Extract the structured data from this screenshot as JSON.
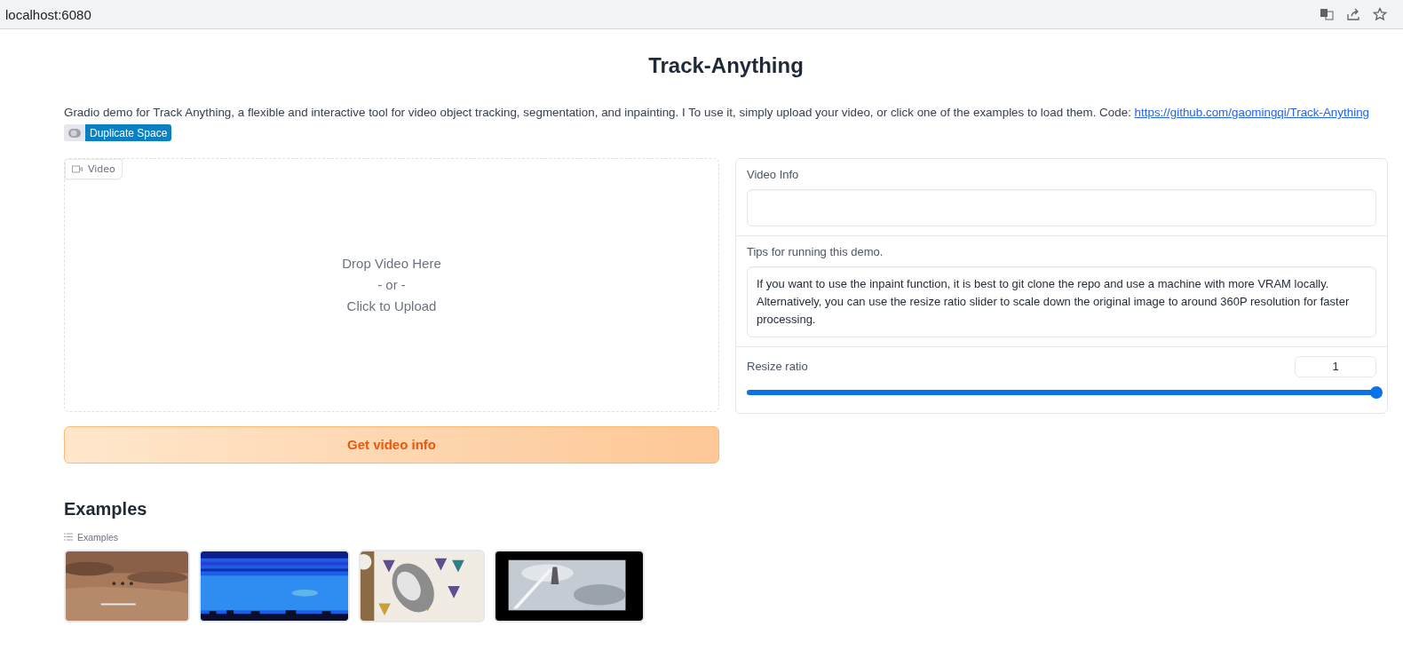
{
  "browser": {
    "address": "localhost:6080"
  },
  "title": "Track-Anything",
  "description": {
    "text": "Gradio demo for Track Anything, a flexible and interactive tool for video object tracking, segmentation, and inpainting. I To use it, simply upload your video, or click one of the examples to load them. Code: ",
    "link": "https://github.com/gaomingqi/Track-Anything"
  },
  "badge": {
    "label": "Duplicate Space"
  },
  "video": {
    "label": "Video",
    "drop_lines": [
      "Drop Video Here",
      "- or -",
      "Click to Upload"
    ]
  },
  "button": {
    "label": "Get video info"
  },
  "video_info": {
    "label": "Video Info"
  },
  "tips": {
    "label": "Tips for running this demo.",
    "value": "If you want to use the inpaint function, it is best to git clone the repo and use a machine with more VRAM locally. Alternatively, you can use the resize ratio slider to scale down the original image to around 360P resolution for faster processing."
  },
  "resize": {
    "label": "Resize ratio",
    "value": "1",
    "level": 1
  },
  "examples": {
    "heading": "Examples",
    "label": "Examples"
  }
}
